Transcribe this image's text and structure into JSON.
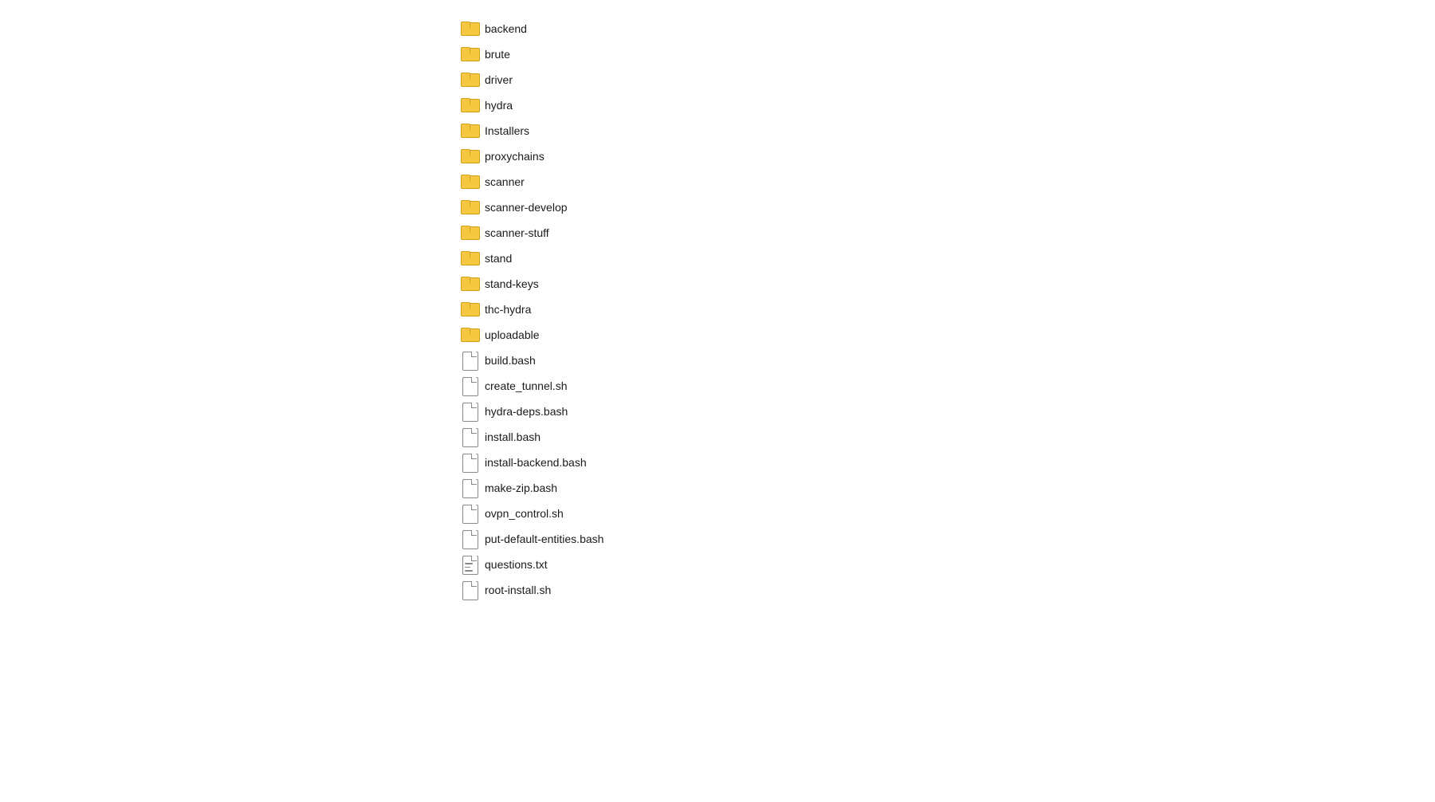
{
  "fileList": {
    "items": [
      {
        "name": "backend",
        "type": "folder"
      },
      {
        "name": "brute",
        "type": "folder"
      },
      {
        "name": "driver",
        "type": "folder"
      },
      {
        "name": "hydra",
        "type": "folder"
      },
      {
        "name": "Installers",
        "type": "folder"
      },
      {
        "name": "proxychains",
        "type": "folder"
      },
      {
        "name": "scanner",
        "type": "folder"
      },
      {
        "name": "scanner-develop",
        "type": "folder"
      },
      {
        "name": "scanner-stuff",
        "type": "folder"
      },
      {
        "name": "stand",
        "type": "folder"
      },
      {
        "name": "stand-keys",
        "type": "folder"
      },
      {
        "name": "thc-hydra",
        "type": "folder"
      },
      {
        "name": "uploadable",
        "type": "folder"
      },
      {
        "name": "build.bash",
        "type": "file"
      },
      {
        "name": "create_tunnel.sh",
        "type": "file"
      },
      {
        "name": "hydra-deps.bash",
        "type": "file"
      },
      {
        "name": "install.bash",
        "type": "file"
      },
      {
        "name": "install-backend.bash",
        "type": "file"
      },
      {
        "name": "make-zip.bash",
        "type": "file"
      },
      {
        "name": "ovpn_control.sh",
        "type": "file"
      },
      {
        "name": "put-default-entities.bash",
        "type": "file"
      },
      {
        "name": "questions.txt",
        "type": "textfile"
      },
      {
        "name": "root-install.sh",
        "type": "file"
      }
    ]
  }
}
